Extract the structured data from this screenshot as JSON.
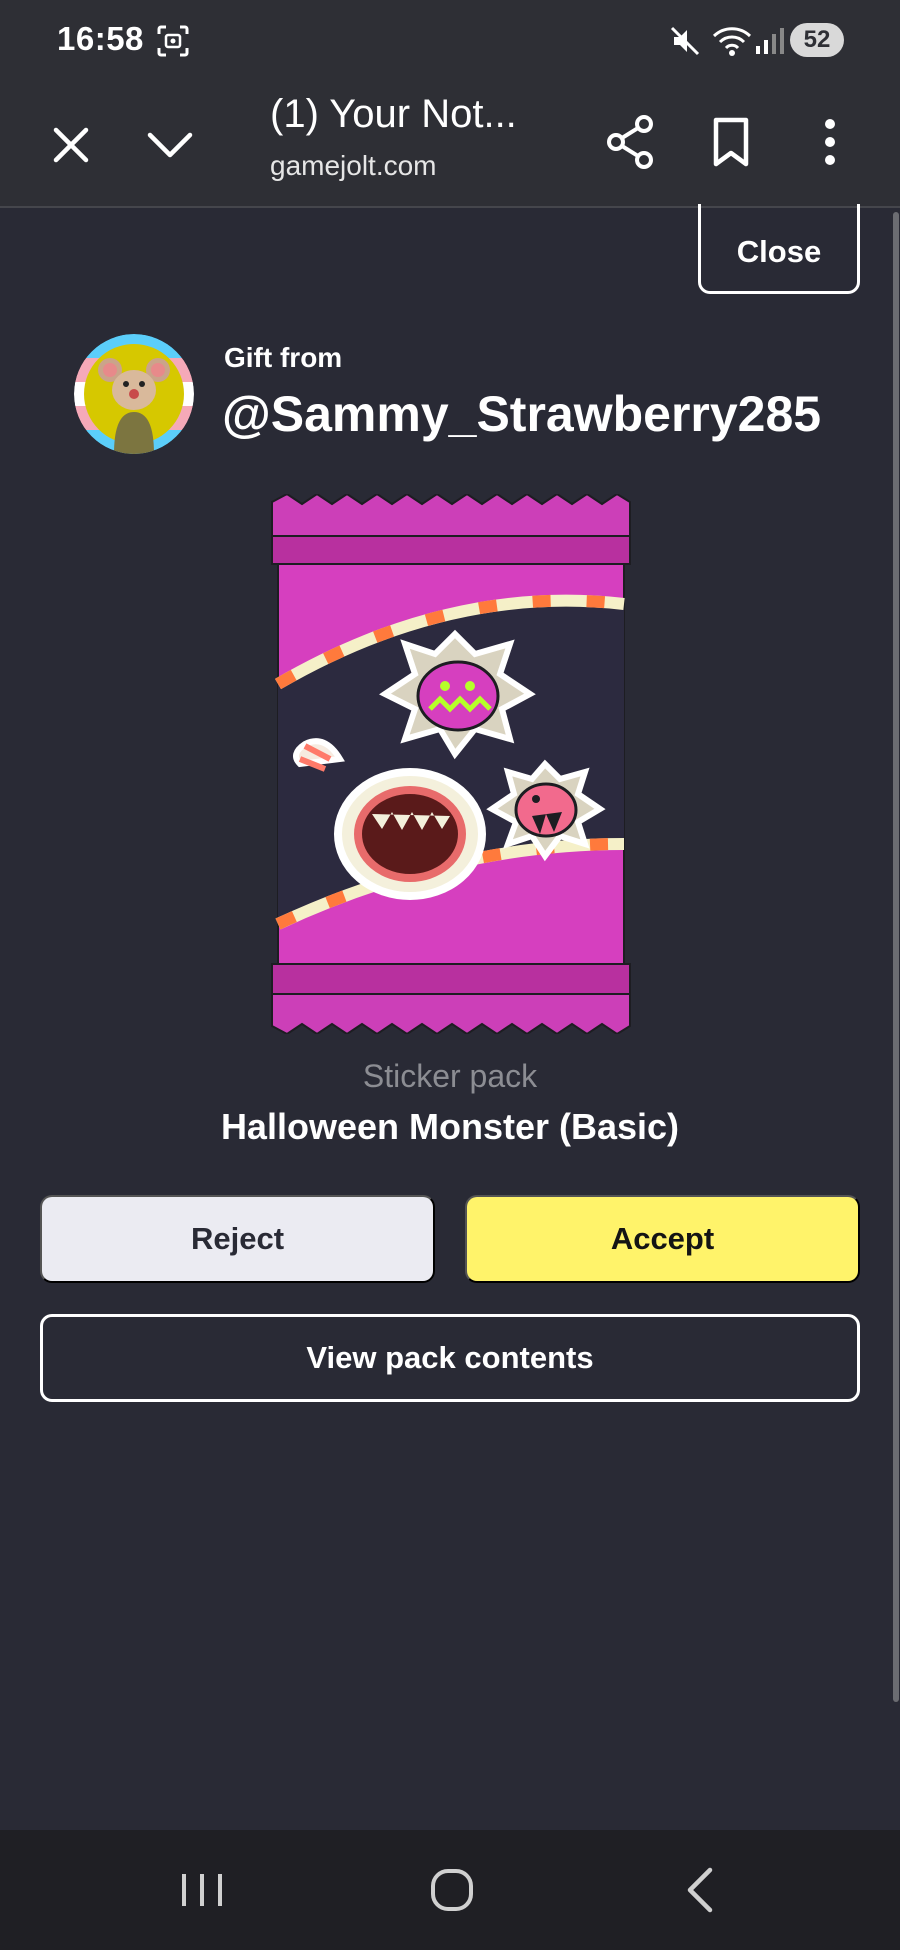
{
  "status_bar": {
    "time": "16:58",
    "battery": "52",
    "icons": [
      "screenshot-icon",
      "mute-icon",
      "wifi-icon",
      "signal-icon"
    ]
  },
  "browser": {
    "title": "(1) Your Not...",
    "url": "gamejolt.com",
    "icons": [
      "close-icon",
      "chevron-down-icon",
      "share-icon",
      "bookmark-icon",
      "more-vert-icon"
    ]
  },
  "dialog": {
    "close_label": "Close",
    "gift_from_label": "Gift from",
    "sender": "@Sammy_Strawberry285",
    "pack_type": "Sticker pack",
    "pack_name": "Halloween Monster (Basic)",
    "reject_label": "Reject",
    "accept_label": "Accept",
    "view_contents_label": "View pack contents"
  },
  "colors": {
    "background": "#292a35",
    "accept": "#fff36a",
    "reject": "#ebebf2",
    "pack_magenta": "#d63fbf"
  },
  "nav": {
    "icons": [
      "recents-icon",
      "home-icon",
      "back-icon"
    ]
  }
}
